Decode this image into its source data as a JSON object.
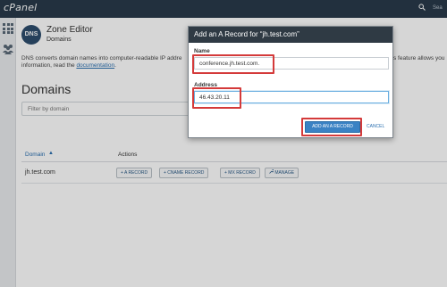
{
  "app": {
    "logo": "cPanel",
    "search_hint": "Sea"
  },
  "header": {
    "badge": "DNS",
    "title": "Zone Editor",
    "subtitle": "Domains"
  },
  "description": {
    "line1": "DNS converts domain names into computer-readable IP addre",
    "line1_tail": "s feature allows you",
    "line2_prefix": "information, read the ",
    "link": "documentation",
    "line2_suffix": "."
  },
  "domains": {
    "heading": "Domains",
    "filter_placeholder": "Filter by domain"
  },
  "table": {
    "col_domain": "Domain",
    "col_actions": "Actions",
    "rows": [
      {
        "domain": "jh.test.com",
        "actions": [
          "+ A RECORD",
          "+ CNAME RECORD",
          "+ MX RECORD",
          "MANAGE"
        ]
      }
    ]
  },
  "modal": {
    "title": "Add an A Record for “jh.test.com”",
    "name_label": "Name",
    "name_value": "conference.jh.test.com.",
    "address_label": "Address",
    "address_value": "46.43.20.11",
    "submit_label": "ADD AN A RECORD",
    "cancel_label": "CANCEL"
  },
  "colors": {
    "topbar": "#293a4a",
    "accent": "#3a82c4",
    "highlight": "#d43a3a"
  },
  "icons": [
    "grid-icon",
    "users-icon",
    "search-icon",
    "sort-up-icon",
    "wrench-icon"
  ]
}
